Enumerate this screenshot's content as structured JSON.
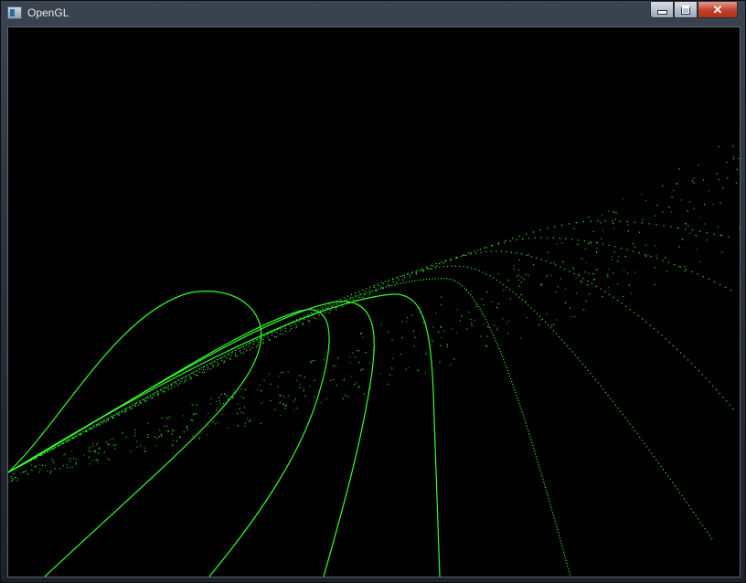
{
  "window": {
    "title": "OpenGL",
    "icons": {
      "app": "window-app-icon",
      "minimize": "minimize-icon",
      "maximize": "maximize-icon",
      "close": "close-icon"
    },
    "close_glyph": "✕"
  },
  "scene": {
    "background": "#000000",
    "line_color": "#33ff2b"
  }
}
